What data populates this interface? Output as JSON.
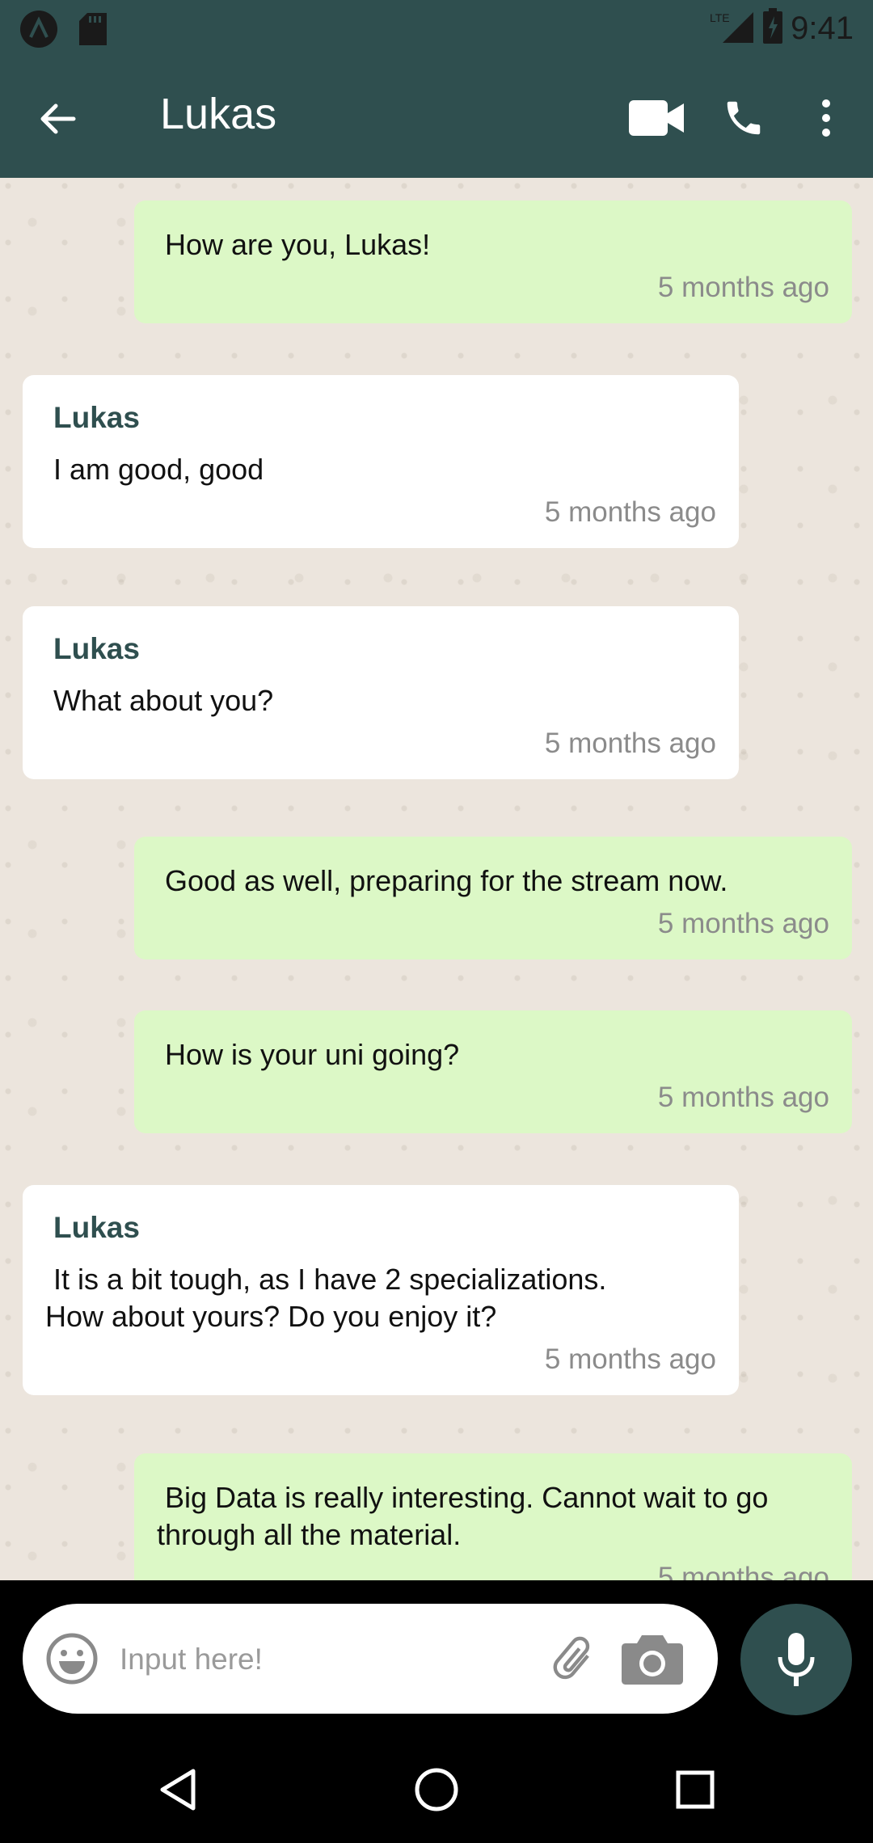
{
  "status_bar": {
    "time": "9:41",
    "network": "LTE",
    "icons": [
      "app-notification-icon",
      "sd-card-icon",
      "signal-icon",
      "battery-icon"
    ]
  },
  "header": {
    "title": "Lukas",
    "icons": [
      "back-arrow-icon",
      "video-call-icon",
      "phone-icon",
      "more-vert-icon"
    ]
  },
  "messages": [
    {
      "direction": "out",
      "text": "How are you, Lukas!",
      "time": "5 months ago"
    },
    {
      "direction": "in",
      "sender": "Lukas",
      "text": "I am good, good",
      "time": "5 months ago"
    },
    {
      "direction": "in",
      "sender": "Lukas",
      "text": "What about you?",
      "time": "5 months ago"
    },
    {
      "direction": "out",
      "text": "Good as well, preparing for the stream now.",
      "time": "5 months ago"
    },
    {
      "direction": "out",
      "text": "How is your uni going?",
      "time": "5 months ago"
    },
    {
      "direction": "in",
      "sender": "Lukas",
      "text": " It is a bit tough, as I have 2 specializations.\nHow about yours? Do you enjoy it?",
      "time": "5 months ago"
    },
    {
      "direction": "out",
      "text": " Big Data is really interesting. Cannot wait to go\nthrough all the material.",
      "time": "5 months ago"
    }
  ],
  "composer": {
    "placeholder": "Input here!",
    "value": "",
    "icons": [
      "emoji-icon",
      "attach-icon",
      "camera-icon",
      "mic-icon"
    ]
  },
  "nav_bar": {
    "icons": [
      "nav-back-icon",
      "nav-home-icon",
      "nav-recents-icon"
    ]
  },
  "colors": {
    "primary": "#2f4f4f",
    "outgoing_bubble": "#dcf8c6",
    "incoming_bubble": "#ffffff",
    "chat_background": "#ece5dd",
    "timestamp": "#8b8b8b"
  }
}
